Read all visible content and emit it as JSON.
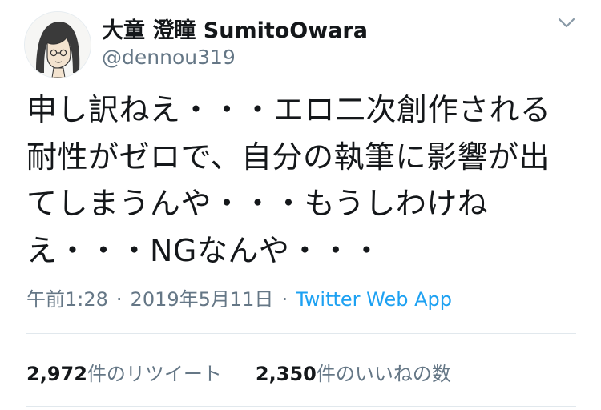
{
  "author": {
    "display_name": "大童 澄瞳 SumitoOwara",
    "handle": "@dennou319",
    "avatar_icon": "avatar-illustration"
  },
  "tweet": {
    "text": "申し訳ねえ・・・エロ二次創作される耐性がゼロで、自分の執筆に影響が出てしまうんや・・・もうしわけねえ・・・NGなんや・・・"
  },
  "meta": {
    "time": "午前1:28",
    "separator": "·",
    "date": "2019年5月11日",
    "source": "Twitter Web App"
  },
  "stats": {
    "retweets": {
      "count": "2,972",
      "label": "件のリツイート"
    },
    "likes": {
      "count": "2,350",
      "label": "件のいいねの数"
    }
  },
  "colors": {
    "text": "#14171a",
    "secondary": "#657786",
    "link": "#1da1f2",
    "divider": "#e1e8ed"
  },
  "icons": {
    "menu": "chevron-down-icon"
  }
}
